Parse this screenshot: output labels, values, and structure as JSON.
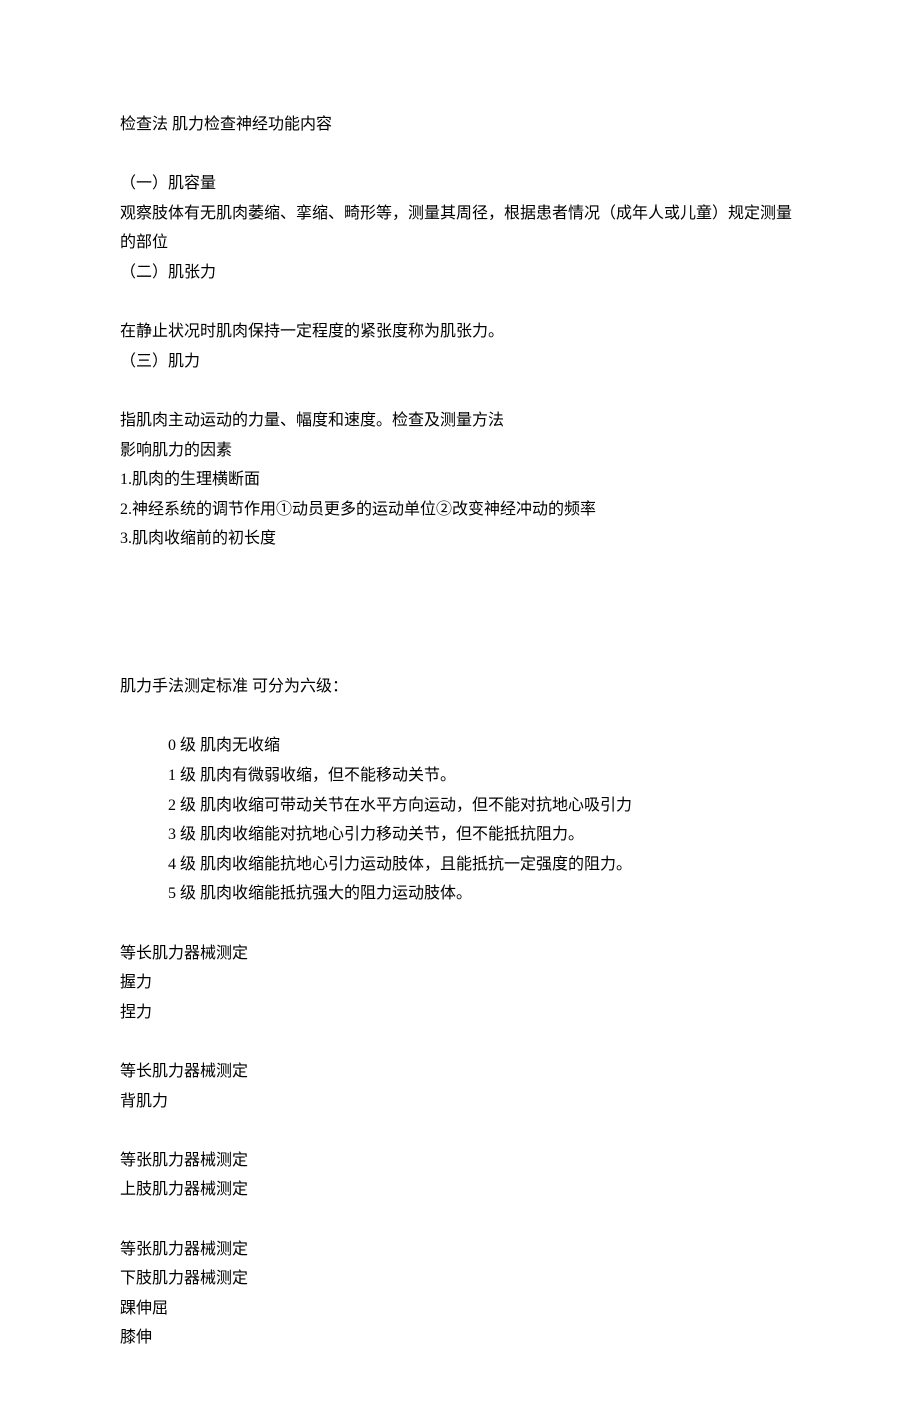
{
  "title": "检查法 肌力检查神经功能内容",
  "sections": [
    {
      "heading": "（一）肌容量",
      "body": [
        "观察肢体有无肌肉萎缩、挛缩、畸形等，测量其周径，根据患者情况（成年人或儿童）规定测量的部位"
      ]
    },
    {
      "heading": "（二）肌张力",
      "body": [
        "在静止状况时肌肉保持一定程度的紧张度称为肌张力。"
      ],
      "gapBefore": true
    },
    {
      "heading": "（三）肌力",
      "body": [
        "指肌肉主动运动的力量、幅度和速度。检查及测量方法",
        "影响肌力的因素",
        "1.肌肉的生理横断面",
        "2.神经系统的调节作用①动员更多的运动单位②改变神经冲动的频率",
        "3.肌肉收缩前的初长度"
      ],
      "gapBefore": true
    }
  ],
  "grades_heading": "肌力手法测定标准   可分为六级：",
  "grades": [
    {
      "level": " 0 级",
      "desc": "肌肉无收缩"
    },
    {
      "level": "1 级",
      "desc": "肌肉有微弱收缩，但不能移动关节。"
    },
    {
      "level": "2 级",
      "desc": "肌肉收缩可带动关节在水平方向运动，但不能对抗地心吸引力"
    },
    {
      "level": "3 级",
      "desc": "肌肉收缩能对抗地心引力移动关节，但不能抵抗阻力。"
    },
    {
      "level": "4 级",
      "desc": "肌肉收缩能抗地心引力运动肢体，且能抵抗一定强度的阻力。"
    },
    {
      "level": "5 级",
      "desc": "肌肉收缩能抵抗强大的阻力运动肢体。"
    }
  ],
  "measurements": [
    {
      "lines": [
        "等长肌力器械测定",
        "握力",
        "捏力"
      ]
    },
    {
      "lines": [
        "等长肌力器械测定",
        "背肌力"
      ]
    },
    {
      "lines": [
        "等张肌力器械测定",
        "上肢肌力器械测定"
      ]
    },
    {
      "lines": [
        "等张肌力器械测定",
        "下肢肌力器械测定",
        "踝伸屈",
        "膝伸"
      ]
    }
  ]
}
